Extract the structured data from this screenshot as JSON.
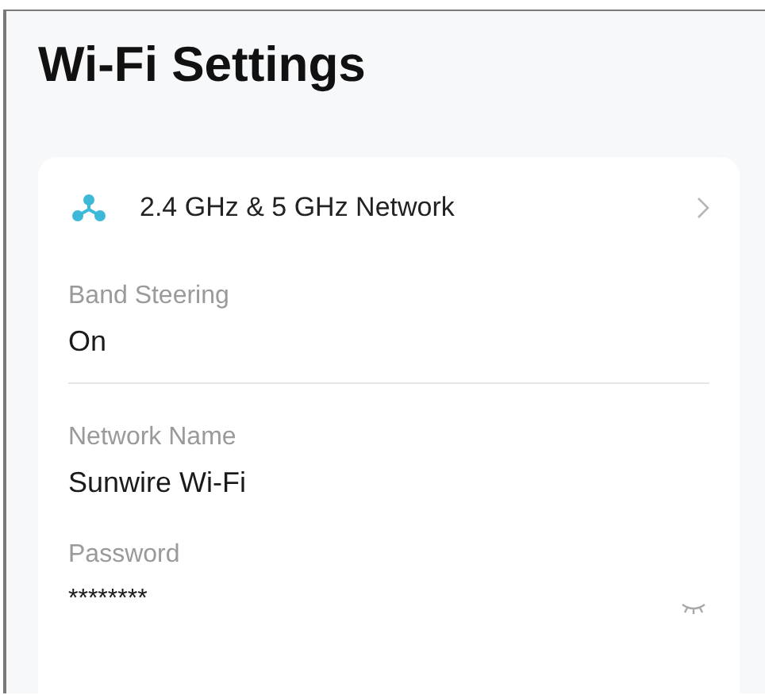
{
  "title": "Wi-Fi Settings",
  "network_row": {
    "label": "2.4 GHz & 5 GHz Network"
  },
  "fields": [
    {
      "kind": "text",
      "label": "Band Steering",
      "value": "On",
      "divider": true
    },
    {
      "kind": "text",
      "label": "Network Name",
      "value": "Sunwire Wi-Fi",
      "divider": false
    },
    {
      "kind": "password",
      "label": "Password",
      "value": "********",
      "divider": false
    }
  ]
}
